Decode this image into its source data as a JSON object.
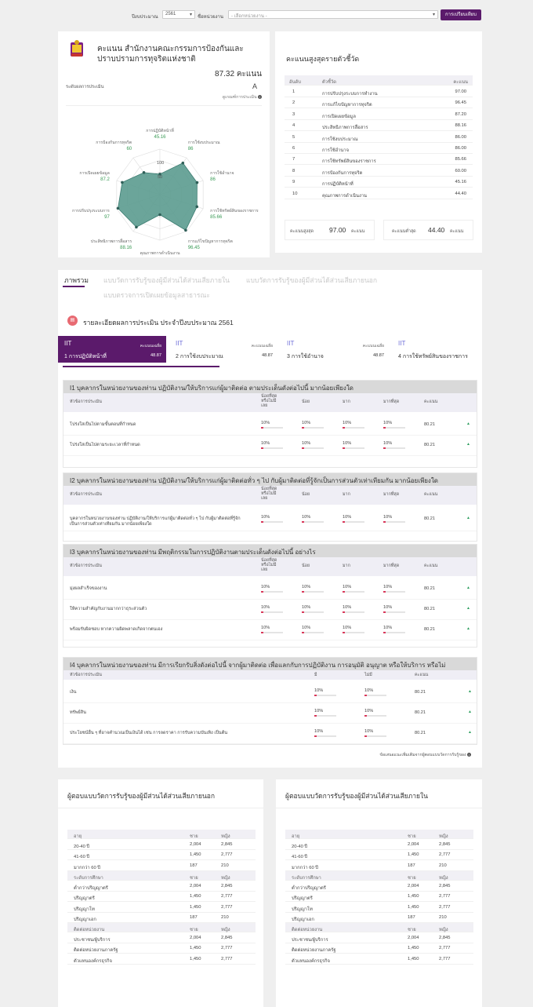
{
  "filters": {
    "year_label": "ปีงบประมาณ",
    "year_value": "2561",
    "agency_label": "ชื่อหน่วยงาน",
    "agency_placeholder": "- เลือกหน่วยงาน -",
    "compare_button": "การเปรียบเทียบ"
  },
  "summary": {
    "org_name": "คะแนน สำนักงานคณะกรรมการป้องกันและปราบปรามการทุจริตแห่งชาติ",
    "score": "87.32 คะแนน",
    "level_label": "ระดับผลการประเมิน",
    "level_value": "A",
    "criteria_link": "ดูเกณฑ์การประเมิน",
    "radar": {
      "center_label": "100",
      "ring_label": "50",
      "axes": [
        {
          "label": "การปฏิบัติหน้าที่",
          "value": "45.16"
        },
        {
          "label": "การใช้งบประมาณ",
          "value": "86"
        },
        {
          "label": "การใช้อำนาจ",
          "value": "86"
        },
        {
          "label": "การใช้ทรัพย์สินของราชการ",
          "value": "85.66"
        },
        {
          "label": "การแก้ไขปัญหาการทุจริต",
          "value": "96.45"
        },
        {
          "label": "คุณภาพการดำเนินงาน",
          "value": "44"
        },
        {
          "label": "ประสิทธิภาพการสื่อสาร",
          "value": "88.16"
        },
        {
          "label": "การปรับปรุงระบบการ",
          "value": "97"
        },
        {
          "label": "การเปิดเผยข้อมูล",
          "value": "87.2"
        },
        {
          "label": "การป้องกันการทุจริต",
          "value": "60"
        }
      ]
    }
  },
  "ranking": {
    "title": "คะแนนสูงสุดรายตัวชี้วัด",
    "headers": [
      "อันดับ",
      "ตัวชี้วัด",
      "คะแนน"
    ],
    "rows": [
      {
        "rank": "1",
        "name": "การปรับปรุงระบบการทำงาน",
        "score": "97.00"
      },
      {
        "rank": "2",
        "name": "การแก้ไขปัญหาการทุจริต",
        "score": "96.45"
      },
      {
        "rank": "3",
        "name": "การเปิดเผยข้อมูล",
        "score": "87.20"
      },
      {
        "rank": "4",
        "name": "ประสิทธิภาพการสื่อสาร",
        "score": "88.16"
      },
      {
        "rank": "5",
        "name": "การใช้งบประมาณ",
        "score": "86.00"
      },
      {
        "rank": "6",
        "name": "การใช้อำนาจ",
        "score": "86.00"
      },
      {
        "rank": "7",
        "name": "การใช้ทรัพย์สินของราชการ",
        "score": "85.66"
      },
      {
        "rank": "8",
        "name": "การป้องกันการทุจริต",
        "score": "60.00"
      },
      {
        "rank": "9",
        "name": "การปฏิบัติหน้าที่",
        "score": "45.16"
      },
      {
        "rank": "10",
        "name": "คุณภาพการดำเนินงาน",
        "score": "44.40"
      }
    ],
    "max_label": "คะแนนสูงสุด",
    "max_value": "97.00",
    "max_unit": "คะแนน",
    "min_label": "คะแนนต่ำสุด",
    "min_value": "44.40",
    "min_unit": "คะแนน"
  },
  "tabs": [
    "ภาพรวม",
    "แบบวัดการรับรู้ของผู้มีส่วนได้ส่วนเสียภายใน",
    "แบบวัดการรับรู้ของผู้มีส่วนได้ส่วนเสียภายนอก",
    "แบบตรวจการเปิดเผยข้อมูลสาธารณะ"
  ],
  "detail": {
    "title": "รายละเอียดผลการประเมิน ประจำปีงบประมาณ 2561",
    "index_cards": [
      {
        "code": "IIT",
        "avg_label": "คะแนนเฉลี่ย",
        "name": "1 การปฏิบัติหน้าที่",
        "value": "48.87"
      },
      {
        "code": "IIT",
        "avg_label": "คะแนนเฉลี่ย",
        "name": "2 การใช้งบประมาณ",
        "value": "48.87"
      },
      {
        "code": "IIT",
        "avg_label": "คะแนนเฉลี่ย",
        "name": "3 การใช้อำนาจ",
        "value": "48.87"
      },
      {
        "code": "IIT",
        "avg_label": "คะแนน",
        "name": "4 การใช้ทรัพย์สินของราชการ",
        "value": ""
      }
    ]
  },
  "sections": [
    {
      "title": "I1 บุคลากรในหน่วยงานของท่าน ปฏิบัติงาน/ให้บริการแก่ผู้มาติดต่อ ตามประเด็นดังต่อไปนี้ มากน้อยเพียงใด",
      "headers": [
        "หัวข้อการประเมิน",
        "น้อยที่สุดหรือไม่มีเลย",
        "น้อย",
        "มาก",
        "มากที่สุด",
        "คะแนน"
      ],
      "rows": [
        {
          "label": "โปร่งใสเป็นไปตามขั้นตอนที่กำหนด",
          "v1": "10%",
          "v2": "10%",
          "v3": "10%",
          "v4": "10%",
          "score": "80.21"
        },
        {
          "label": "โปร่งใสเป็นไปตามระยะเวลาที่กำหนด",
          "v1": "10%",
          "v2": "10%",
          "v3": "10%",
          "v4": "10%",
          "score": "80.21"
        }
      ]
    },
    {
      "title": "I2 บุคลากรในหน่วยงานของท่าน ปฏิบัติงาน/ให้บริการแก่ผู้มาติดต่อทั่ว ๆ ไป กับผู้มาติดต่อที่รู้จักเป็นการส่วนตัวเท่าเทียมกัน มากน้อยเพียงใด",
      "headers": [
        "หัวข้อการประเมิน",
        "น้อยที่สุดหรือไม่มีเลย",
        "น้อย",
        "มาก",
        "มากที่สุด",
        "คะแนน"
      ],
      "rows": [
        {
          "label": "บุคลากรในหน่วยงานของท่าน ปฏิบัติงาน/ให้บริการแก่ผู้มาติดต่อทั่ว ๆ ไป กับผู้มาติดต่อที่รู้จักเป็นการส่วนตัวเท่าเทียมกัน มากน้อยเพียงใด",
          "v1": "10%",
          "v2": "10%",
          "v3": "10%",
          "v4": "10%",
          "score": "80.21"
        }
      ]
    },
    {
      "title": "I3 บุคลากรในหน่วยงานของท่าน มีพฤติกรรมในการปฏิบัติงานตามประเด็นดังต่อไปนี้ อย่างไร",
      "headers": [
        "หัวข้อการประเมิน",
        "น้อยที่สุดหรือไม่มีเลย",
        "น้อย",
        "มาก",
        "มากที่สุด",
        "คะแนน"
      ],
      "rows": [
        {
          "label": "มุ่งผลสำเร็จของงาน",
          "v1": "10%",
          "v2": "10%",
          "v3": "10%",
          "v4": "10%",
          "score": "80.21"
        },
        {
          "label": "ให้ความสำคัญกับงานมากกว่าธุระส่วนตัว",
          "v1": "10%",
          "v2": "10%",
          "v3": "10%",
          "v4": "10%",
          "score": "80.21"
        },
        {
          "label": "พร้อมรับผิดชอบ หากความผิดพลาดเกิดจากตนเอง",
          "v1": "10%",
          "v2": "10%",
          "v3": "10%",
          "v4": "10%",
          "score": "80.21"
        }
      ]
    },
    {
      "title": "I4 บุคลากรในหน่วยงานของท่าน มีการเรียกรับสิ่งดังต่อไปนี้ จากผู้มาติดต่อ เพื่อแลกกับการปฏิบัติงาน การอนุมัติ อนุญาต หรือให้บริการ หรือไม่",
      "headers": [
        "หัวข้อการประเมิน",
        "มี",
        "ไม่มี",
        "คะแนน"
      ],
      "rows": [
        {
          "label": "เงิน",
          "v1": "10%",
          "v2": "10%",
          "score": "80.21"
        },
        {
          "label": "ทรัพย์สิน",
          "v1": "10%",
          "v2": "10%",
          "score": "80.21"
        },
        {
          "label": "ประโยชน์อื่น ๆ ที่อาจคำนวณเป็นเงินได้ เช่น การลดราคา การรับความบันเทิง เป็นต้น",
          "v1": "10%",
          "v2": "10%",
          "score": "80.21"
        }
      ]
    }
  ],
  "footnote": "ข้อเสนอแนะเพิ่มเติมจากผู้ตอบแบบวัดการรับรู้ของ",
  "respondents": [
    {
      "title": "ผู้ตอบแบบวัดการรับรู้ของผู้มีส่วนได้ส่วนเสียภายนอก",
      "groups": [
        {
          "head": [
            "อายุ",
            "ชาย",
            "หญิง"
          ],
          "rows": [
            [
              "20-40 ปี",
              "2,004",
              "2,845"
            ],
            [
              "41-60 ปี",
              "1,450",
              "2,777"
            ],
            [
              "มากกว่า 60 ปี",
              "187",
              "210"
            ]
          ]
        },
        {
          "head": [
            "ระดับการศึกษา",
            "ชาย",
            "หญิง"
          ],
          "rows": [
            [
              "ต่ำกว่าปริญญาตรี",
              "2,004",
              "2,845"
            ],
            [
              "ปริญญาตรี",
              "1,450",
              "2,777"
            ],
            [
              "ปริญญาโท",
              "1,450",
              "2,777"
            ],
            [
              "ปริญญาเอก",
              "187",
              "210"
            ]
          ]
        },
        {
          "head": [
            "ติดต่อหน่วยงาน",
            "ชาย",
            "หญิง"
          ],
          "rows": [
            [
              "ประชาชน/ผู้บริการ",
              "2,004",
              "2,845"
            ],
            [
              "ติดต่อหน่วยงานภาครัฐ",
              "1,450",
              "2,777"
            ],
            [
              "ตัวแทนองค์กรธุรกิจ",
              "1,450",
              "2,777"
            ]
          ]
        }
      ]
    },
    {
      "title": "ผู้ตอบแบบวัดการรับรู้ของผู้มีส่วนได้ส่วนเสียภายใน",
      "groups": [
        {
          "head": [
            "อายุ",
            "ชาย",
            "หญิง"
          ],
          "rows": [
            [
              "20-40 ปี",
              "2,004",
              "2,845"
            ],
            [
              "41-60 ปี",
              "1,450",
              "2,777"
            ],
            [
              "มากกว่า 60 ปี",
              "187",
              "210"
            ]
          ]
        },
        {
          "head": [
            "ระดับการศึกษา",
            "ชาย",
            "หญิง"
          ],
          "rows": [
            [
              "ต่ำกว่าปริญญาตรี",
              "2,004",
              "2,845"
            ],
            [
              "ปริญญาตรี",
              "1,450",
              "2,777"
            ],
            [
              "ปริญญาโท",
              "1,450",
              "2,777"
            ],
            [
              "ปริญญาเอก",
              "187",
              "210"
            ]
          ]
        },
        {
          "head": [
            "ติดต่อหน่วยงาน",
            "ชาย",
            "หญิง"
          ],
          "rows": [
            [
              "ประชาชน/ผู้บริการ",
              "2,004",
              "2,845"
            ],
            [
              "ติดต่อหน่วยงานภาครัฐ",
              "1,450",
              "2,777"
            ],
            [
              "ตัวแทนองค์กรธุรกิจ",
              "1,450",
              "2,777"
            ]
          ]
        }
      ]
    }
  ]
}
